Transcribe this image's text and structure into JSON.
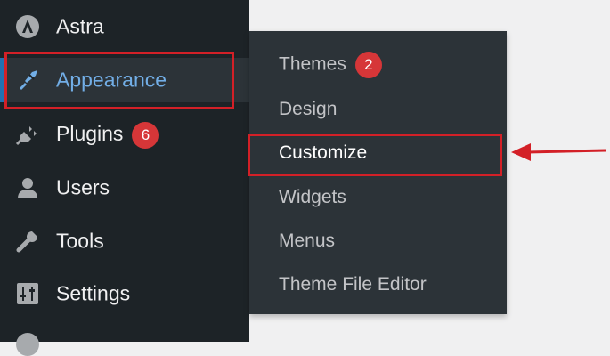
{
  "sidebar": {
    "items": [
      {
        "label": "Astra",
        "icon": "astra-logo-icon"
      },
      {
        "label": "Appearance",
        "icon": "paintbrush-icon",
        "active": true
      },
      {
        "label": "Plugins",
        "icon": "plugin-icon",
        "badge": "6"
      },
      {
        "label": "Users",
        "icon": "user-icon"
      },
      {
        "label": "Tools",
        "icon": "wrench-icon"
      },
      {
        "label": "Settings",
        "icon": "sliders-icon"
      }
    ]
  },
  "submenu": {
    "items": [
      {
        "label": "Themes",
        "badge": "2"
      },
      {
        "label": "Design"
      },
      {
        "label": "Customize",
        "highlighted": true
      },
      {
        "label": "Widgets"
      },
      {
        "label": "Menus"
      },
      {
        "label": "Theme File Editor"
      }
    ]
  },
  "colors": {
    "sidebar_bg": "#1d2327",
    "submenu_bg": "#2c3338",
    "active_text": "#72aee6",
    "badge": "#d63638",
    "annotation_red": "#d32027",
    "page_bg": "#f0f0f1"
  }
}
